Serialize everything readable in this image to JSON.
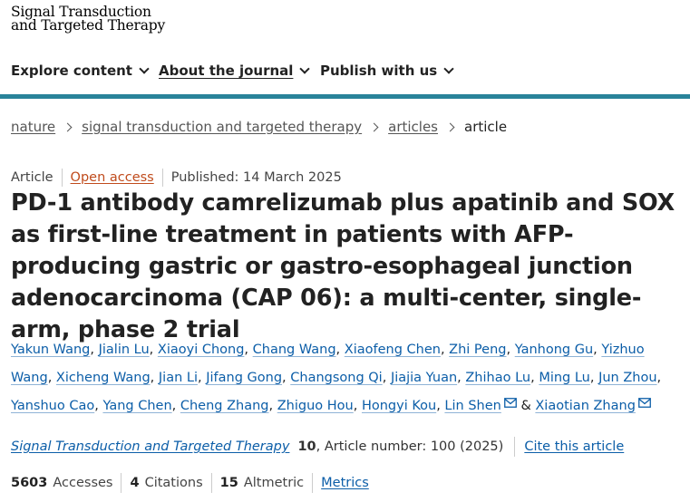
{
  "logo": {
    "line1": "Signal Transduction",
    "line2": "and Targeted Therapy"
  },
  "nav": {
    "explore": "Explore content",
    "about": "About the journal",
    "publish": "Publish with us"
  },
  "breadcrumb": {
    "items": [
      "nature",
      "signal transduction and targeted therapy",
      "articles"
    ],
    "current": "article"
  },
  "meta": {
    "type": "Article",
    "access": "Open access",
    "published": "Published: 14 March 2025"
  },
  "title": "PD-1 antibody camrelizumab plus apatinib and SOX as first-line treatment in patients with AFP-producing gastric or gastro-esophageal junction adenocarcinoma (CAP 06): a multi-center, single-arm, phase 2 trial",
  "authors": [
    "Yakun Wang",
    "Jialin Lu",
    "Xiaoyi Chong",
    "Chang Wang",
    "Xiaofeng Chen",
    "Zhi Peng",
    "Yanhong Gu",
    "Yizhuo Wang",
    "Xicheng Wang",
    "Jian Li",
    "Jifang Gong",
    "Changsong Qi",
    "Jiajia Yuan",
    "Zhihao Lu",
    "Ming Lu",
    "Jun Zhou",
    "Yanshuo Cao",
    "Yang Chen",
    "Cheng Zhang",
    "Zhiguo Hou",
    "Hongyi Kou",
    "Lin Shen",
    "Xiaotian Zhang"
  ],
  "authors_sep": ", ",
  "authors_last_sep": " & ",
  "citation": {
    "journal": "Signal Transduction and Targeted Therapy",
    "volume": "10",
    "rest": ", Article number: 100 (2025)",
    "cite_link": "Cite this article"
  },
  "metrics": {
    "accesses_value": "5603",
    "accesses_label": "Accesses",
    "citations_value": "4",
    "citations_label": "Citations",
    "altmetric_value": "15",
    "altmetric_label": "Altmetric",
    "metrics_link": "Metrics"
  },
  "colors": {
    "accent": "#29839a",
    "link": "#0c5ea8",
    "open_access": "#c04b1c"
  },
  "icons": {
    "corresponding": "mail-icon",
    "dropdown": "chevron-down-icon",
    "separator": "chevron-right-icon"
  }
}
